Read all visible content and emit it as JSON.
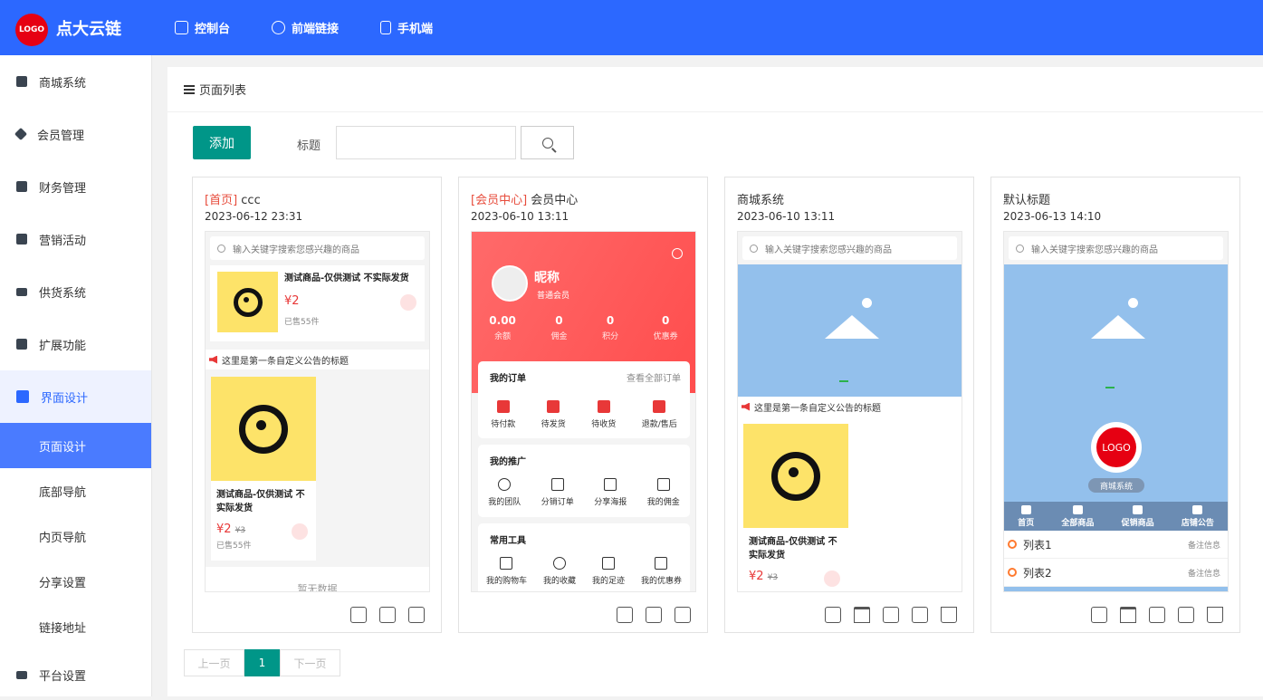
{
  "topbar": {
    "logo_text": "LOGO",
    "brand": "点大云链",
    "nav": [
      {
        "label": "控制台"
      },
      {
        "label": "前端链接"
      },
      {
        "label": "手机端"
      }
    ]
  },
  "sidebar": {
    "items": [
      {
        "label": "商城系统"
      },
      {
        "label": "会员管理"
      },
      {
        "label": "财务管理"
      },
      {
        "label": "营销活动"
      },
      {
        "label": "供货系统"
      },
      {
        "label": "扩展功能"
      },
      {
        "label": "界面设计"
      }
    ],
    "sub_items": [
      {
        "label": "页面设计"
      },
      {
        "label": "底部导航"
      },
      {
        "label": "内页导航"
      },
      {
        "label": "分享设置"
      },
      {
        "label": "链接地址"
      }
    ],
    "bottom_item": {
      "label": "平台设置"
    }
  },
  "main": {
    "heading": "页面列表",
    "add_button": "添加",
    "title_label": "标题",
    "title_input_value": ""
  },
  "cards": [
    {
      "tag": "[首页]",
      "title": " ccc",
      "date": "2023-06-12 23:31"
    },
    {
      "tag": "[会员中心]",
      "title": " 会员中心",
      "date": "2023-06-10 13:11"
    },
    {
      "tag": "",
      "title": "商城系统",
      "date": "2023-06-10 13:11"
    },
    {
      "tag": "",
      "title": "默认标题",
      "date": "2023-06-13 14:10"
    }
  ],
  "preview": {
    "search_placeholder": "输入关键字搜索您感兴趣的商品",
    "product_name": "测试商品-仅供测试 不实际发货",
    "product_name_short": "测试商品-仅供测试 不实际发货",
    "price": "¥2",
    "old_price": "¥3",
    "sold": "已售55件",
    "notice": "这里是第一条自定义公告的标题",
    "more_text": "暂无数据",
    "member": {
      "nickname": "昵称",
      "level": "普通会员",
      "stats": [
        {
          "value": "0.00",
          "label": "余额"
        },
        {
          "value": "0",
          "label": "佣金"
        },
        {
          "value": "0",
          "label": "积分"
        },
        {
          "value": "0",
          "label": "优惠券"
        }
      ],
      "orders_title": "我的订单",
      "orders_all": "查看全部订单",
      "orders": [
        "待付款",
        "待发货",
        "待收货",
        "退款/售后"
      ],
      "promo_title": "我的推广",
      "promo": [
        "我的团队",
        "分销订单",
        "分享海报",
        "我的佣金"
      ],
      "tools_title": "常用工具",
      "tools": [
        "我的购物车",
        "我的收藏",
        "我的足迹",
        "我的优惠券"
      ]
    },
    "shop_logo": "LOGO",
    "shop_name": "商城系统",
    "shop_nav": [
      "首页",
      "全部商品",
      "促销商品",
      "店铺公告"
    ],
    "list_rows": [
      {
        "label": "列表1",
        "note": "备注信息"
      },
      {
        "label": "列表2",
        "note": "备注信息"
      }
    ]
  },
  "pager": {
    "prev": "上一页",
    "current": "1",
    "next": "下一页"
  }
}
